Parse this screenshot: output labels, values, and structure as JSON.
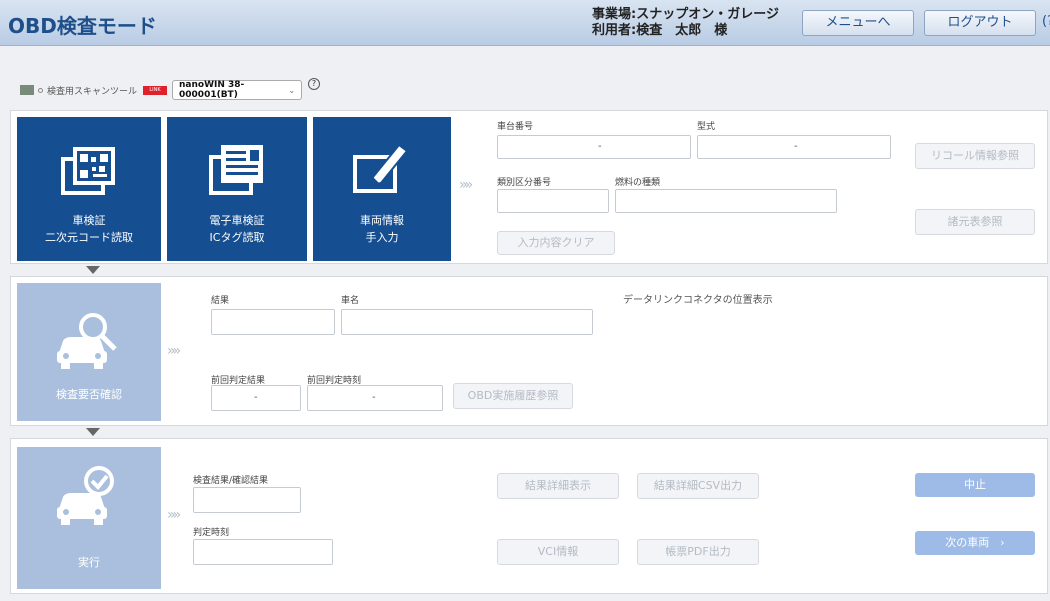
{
  "header": {
    "title": "OBD検査モード",
    "facility": "事業場:スナップオン・ガレージ",
    "user": "利用者:検査　太郎　様",
    "menu_button": "メニューへ",
    "logout_button": "ログアウト",
    "help_glyph": "(?"
  },
  "scan_tool": {
    "label": "検査用スキャンツール",
    "badge": "LINK",
    "selected_device": "nanoWIN 38-000001(BT)",
    "help": "?"
  },
  "vehicle_input": {
    "tiles": [
      {
        "line1": "車検証",
        "line2": "二次元コード読取",
        "icon": "qr-code-icon"
      },
      {
        "line1": "電子車検証",
        "line2": "ICタグ読取",
        "icon": "ic-card-icon"
      },
      {
        "line1": "車両情報",
        "line2": "手入力",
        "icon": "edit-pen-icon"
      }
    ],
    "chevron": "»»",
    "fields": {
      "chassis_number_label": "車台番号",
      "chassis_number_value": "-",
      "model_label": "型式",
      "model_value": "-",
      "category_label": "類別区分番号",
      "fuel_label": "燃料の種類"
    },
    "clear_button": "入力内容クリア",
    "recall_button": "リコール情報参照",
    "manufacturer_button": "諸元表参照"
  },
  "target_check": {
    "tile_caption": "検査要否確認",
    "icon": "car-search-icon",
    "chevron": "»»",
    "result_label": "結果",
    "car_name_label": "車名",
    "dlc_label": "データリンクコネクタの位置表示",
    "prev_result_label": "前回判定結果",
    "prev_result_value": "-",
    "prev_time_label": "前回判定時刻",
    "prev_time_value": "-",
    "history_button": "OBD実施履歴参照"
  },
  "execution": {
    "tile_caption": "実行",
    "icon": "car-check-icon",
    "chevron": "»»",
    "result_label": "検査結果/確認結果",
    "time_label": "判定時刻",
    "detail_button": "結果詳細表示",
    "csv_button": "結果詳細CSV出力",
    "vci_button": "VCI情報",
    "pdf_button": "帳票PDF出力",
    "stop_button": "中止",
    "next_button": "次の車両　›"
  }
}
